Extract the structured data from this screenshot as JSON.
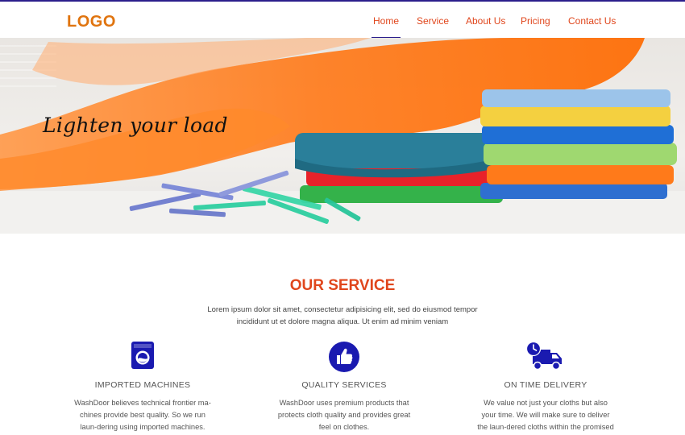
{
  "header": {
    "logo": "LOGO",
    "nav": [
      "Home",
      "Service",
      "About Us",
      "Pricing",
      "Contact Us"
    ],
    "active_nav": "Home"
  },
  "hero": {
    "tagline": "Lighten your load"
  },
  "service": {
    "title": "OUR SERVICE",
    "description": "Lorem ipsum dolor sit amet, consectetur adipisicing elit, sed do eiusmod tempor incididunt ut et dolore magna aliqua. Ut enim ad minim veniam",
    "features": [
      {
        "icon": "washing-machine-icon",
        "title": "IMPORTED MACHINES",
        "text": "WashDoor believes technical frontier ma-chines provide best quality. So we run laun-dering using imported machines."
      },
      {
        "icon": "thumbs-up-icon",
        "title": "QUALITY SERVICES",
        "text": "WashDoor uses premium products that protects cloth quality and provides great feel on clothes."
      },
      {
        "icon": "delivery-truck-icon",
        "title": "ON TIME DELIVERY",
        "text": "We value not just your cloths but also your time. We will make sure to deliver the laun-dered cloths within the promised time."
      }
    ]
  },
  "colors": {
    "accent_orange": "#e0740f",
    "accent_red": "#e0461c",
    "navy": "#2b1e8c",
    "icon_blue": "#1a1ab0"
  }
}
